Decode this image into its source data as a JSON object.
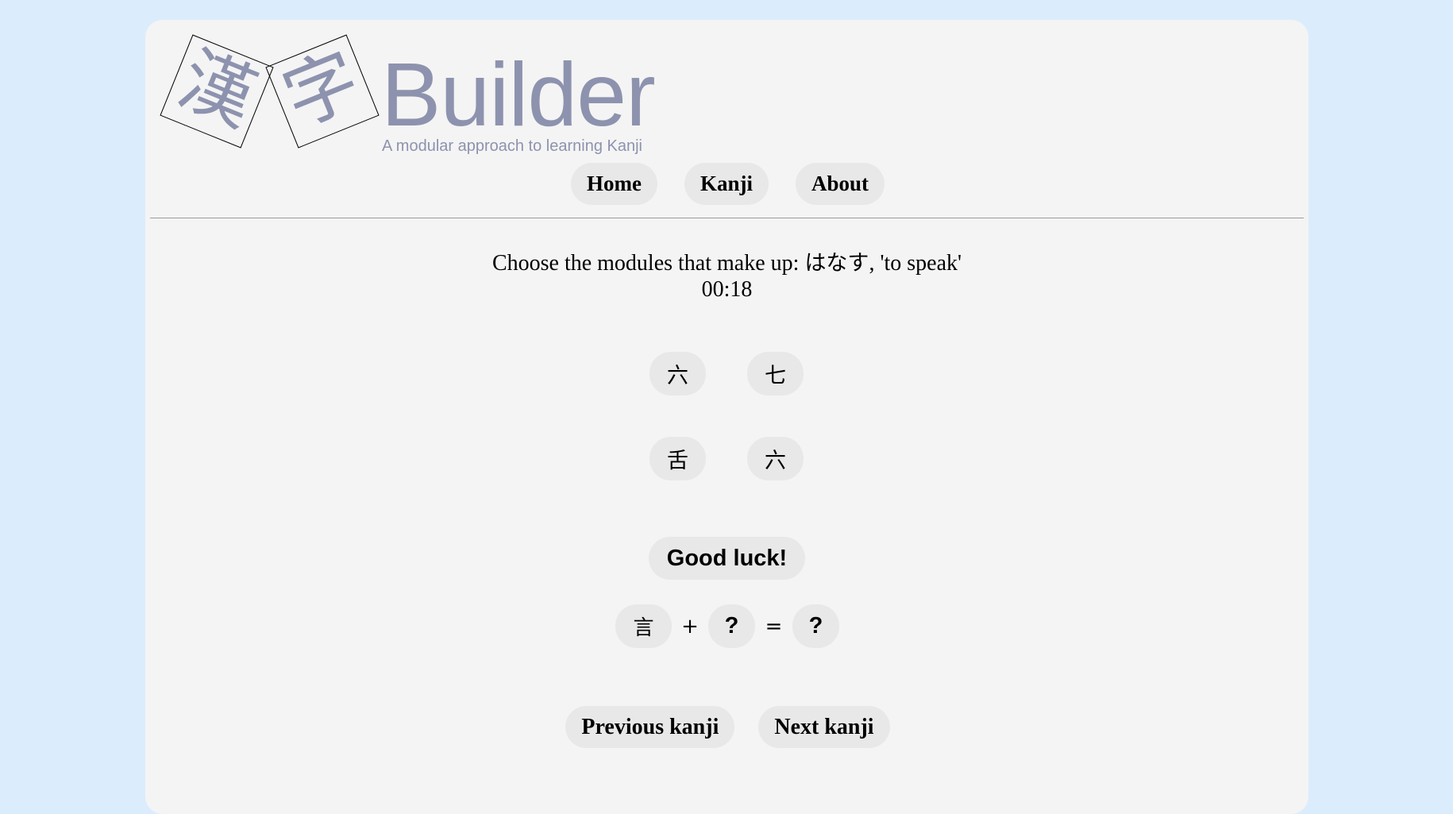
{
  "header": {
    "logo_kanji": [
      "漢",
      "字"
    ],
    "title": "Builder",
    "subtitle": "A modular approach to learning Kanji",
    "brand_color": "#8d93ae"
  },
  "nav": {
    "items": [
      {
        "label": "Home"
      },
      {
        "label": "Kanji"
      },
      {
        "label": "About"
      }
    ]
  },
  "quiz": {
    "prompt_prefix": "Choose the modules that make up: ",
    "reading": "はなす",
    "meaning_suffix": ", 'to speak'",
    "timer": "00:18",
    "options": [
      "六",
      "七",
      "舌",
      "六"
    ],
    "status": "Good luck!",
    "equation": {
      "known_module": "言",
      "plus": "+",
      "unknown_module": "?",
      "equals": "=",
      "result": "?"
    }
  },
  "pager": {
    "previous_label": "Previous kanji",
    "next_label": "Next kanji"
  },
  "colors": {
    "page_background": "#dbecfd",
    "card_background": "#f4f4f4",
    "button_background": "#e8e8e8"
  }
}
